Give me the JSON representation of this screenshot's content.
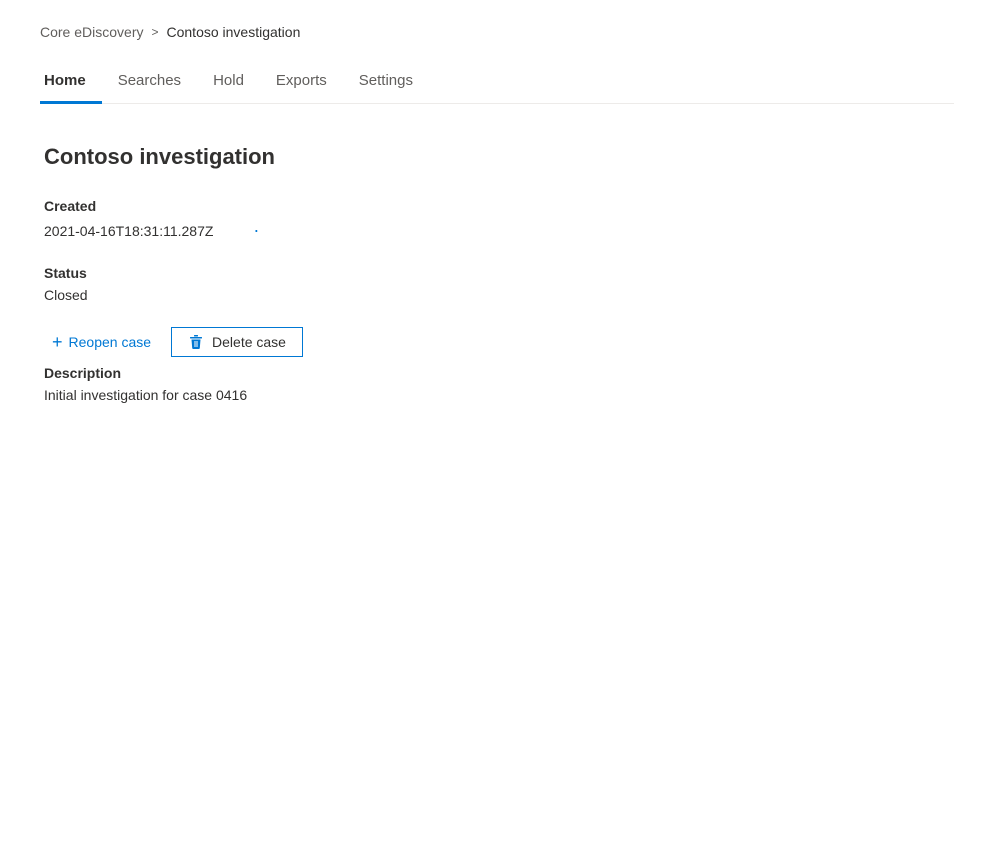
{
  "breadcrumb": {
    "parent_label": "Core eDiscovery",
    "separator": ">",
    "current_label": "Contoso investigation"
  },
  "tabs": [
    {
      "id": "home",
      "label": "Home",
      "active": true
    },
    {
      "id": "searches",
      "label": "Searches",
      "active": false
    },
    {
      "id": "hold",
      "label": "Hold",
      "active": false
    },
    {
      "id": "exports",
      "label": "Exports",
      "active": false
    },
    {
      "id": "settings",
      "label": "Settings",
      "active": false
    }
  ],
  "case": {
    "title": "Contoso investigation",
    "created_label": "Created",
    "created_value": "2021-04-16T18:31:11.287Z",
    "status_label": "Status",
    "status_value": "Closed",
    "description_label": "Description",
    "description_value": "Initial investigation for case 0416"
  },
  "actions": {
    "reopen_label": "Reopen case",
    "delete_label": "Delete case"
  }
}
